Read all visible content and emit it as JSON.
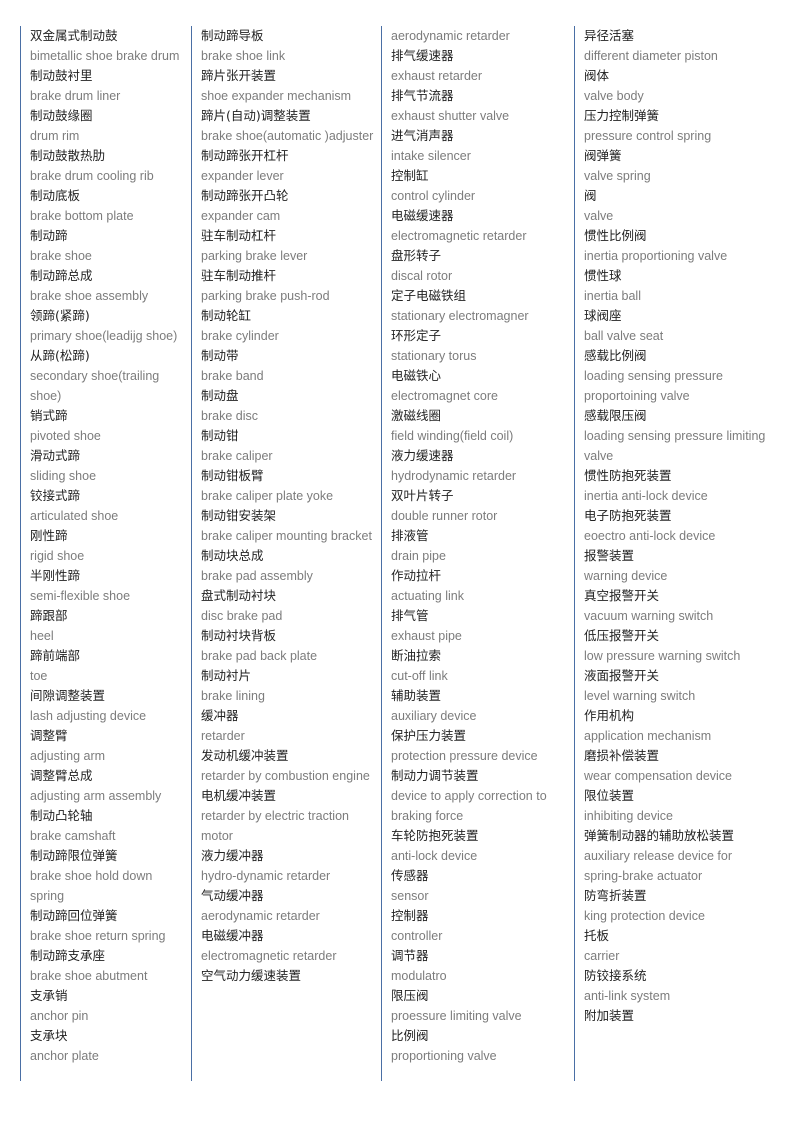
{
  "document": {
    "title": "Brake Component Chinese-English Glossary",
    "colors": {
      "column_rule": "#4a6fa5",
      "chinese_text": "#222222",
      "english_text": "#7c7c7c",
      "background": "#ffffff"
    }
  },
  "columns": [
    {
      "id": "column-1",
      "entries": [
        {
          "cn": "双金属式制动鼓",
          "en": "bimetallic shoe brake drum"
        },
        {
          "cn": "制动鼓衬里",
          "en": "brake drum liner"
        },
        {
          "cn": "制动鼓缘圈",
          "en": "drum rim"
        },
        {
          "cn": "制动鼓散热肋",
          "en": "brake drum cooling rib"
        },
        {
          "cn": "制动底板",
          "en": "brake bottom plate"
        },
        {
          "cn": "制动蹄",
          "en": "brake shoe"
        },
        {
          "cn": "制动蹄总成",
          "en": "brake shoe assembly"
        },
        {
          "cn": "领蹄(紧蹄)",
          "en": "primary shoe(leadijg shoe)"
        },
        {
          "cn": "从蹄(松蹄)",
          "en": "secondary shoe(trailing shoe)"
        },
        {
          "cn": "销式蹄",
          "en": "pivoted shoe"
        },
        {
          "cn": "滑动式蹄",
          "en": "sliding shoe"
        },
        {
          "cn": "铰接式蹄",
          "en": "articulated shoe"
        },
        {
          "cn": "刚性蹄",
          "en": "rigid shoe"
        },
        {
          "cn": "半刚性蹄",
          "en": "semi-flexible shoe"
        },
        {
          "cn": "蹄跟部",
          "en": "heel"
        },
        {
          "cn": "蹄前端部",
          "en": "toe"
        },
        {
          "cn": "间隙调整装置",
          "en": "lash adjusting device"
        },
        {
          "cn": "调整臂",
          "en": "adjusting arm"
        },
        {
          "cn": "调整臂总成",
          "en": "adjusting arm assembly"
        },
        {
          "cn": "制动凸轮轴",
          "en": "brake camshaft"
        },
        {
          "cn": "制动蹄限位弹簧",
          "en": "brake shoe hold down spring"
        },
        {
          "cn": "制动蹄回位弹簧",
          "en": "brake shoe return spring"
        },
        {
          "cn": "制动蹄支承座",
          "en": "brake shoe abutment"
        },
        {
          "cn": "支承销",
          "en": "anchor pin"
        },
        {
          "cn": "支承块",
          "en": "anchor plate"
        }
      ]
    },
    {
      "id": "column-2",
      "entries": [
        {
          "cn": "制动蹄导板",
          "en": "brake shoe link"
        },
        {
          "cn": "蹄片张开装置",
          "en": "shoe expander mechanism"
        },
        {
          "cn": "蹄片(自动)调整装置",
          "en": "brake shoe(automatic )adjuster"
        },
        {
          "cn": "制动蹄张开杠杆",
          "en": "expander lever"
        },
        {
          "cn": "制动蹄张开凸轮",
          "en": "expander cam"
        },
        {
          "cn": "驻车制动杠杆",
          "en": "parking brake lever"
        },
        {
          "cn": "驻车制动推杆",
          "en": "parking brake push-rod"
        },
        {
          "cn": "制动轮缸",
          "en": "brake cylinder"
        },
        {
          "cn": "制动带",
          "en": "brake band"
        },
        {
          "cn": "制动盘",
          "en": "brake disc"
        },
        {
          "cn": "制动钳",
          "en": "brake caliper"
        },
        {
          "cn": "制动钳板臂",
          "en": "brake caliper plate yoke"
        },
        {
          "cn": "制动钳安装架",
          "en": "brake caliper mounting bracket"
        },
        {
          "cn": "制动块总成",
          "en": "brake pad assembly"
        },
        {
          "cn": "盘式制动衬块",
          "en": "disc brake pad"
        },
        {
          "cn": "制动衬块背板",
          "en": "brake pad back plate"
        },
        {
          "cn": "制动衬片",
          "en": "brake lining"
        },
        {
          "cn": "缓冲器",
          "en": "retarder"
        },
        {
          "cn": "发动机缓冲装置",
          "en": "retarder by combustion engine"
        },
        {
          "cn": "电机缓冲装置",
          "en": "retarder by electric traction motor"
        },
        {
          "cn": "液力缓冲器",
          "en": "hydro-dynamic retarder"
        },
        {
          "cn": "气动缓冲器",
          "en": "aerodynamic retarder"
        },
        {
          "cn": "电磁缓冲器",
          "en": "electromagnetic retarder"
        },
        {
          "cn": "空气动力缓速装置",
          "en": ""
        }
      ]
    },
    {
      "id": "column-3",
      "entries": [
        {
          "cn": "",
          "en": "aerodynamic retarder"
        },
        {
          "cn": "排气缓速器",
          "en": "exhaust retarder"
        },
        {
          "cn": "排气节流器",
          "en": "exhaust shutter valve"
        },
        {
          "cn": "进气消声器",
          "en": "intake silencer"
        },
        {
          "cn": "控制缸",
          "en": "control cylinder"
        },
        {
          "cn": "电磁缓速器",
          "en": "electromagnetic retarder"
        },
        {
          "cn": "盘形转子",
          "en": "discal rotor"
        },
        {
          "cn": "定子电磁铁组",
          "en": "stationary electromagner"
        },
        {
          "cn": "环形定子",
          "en": "stationary torus"
        },
        {
          "cn": "电磁铁心",
          "en": "electromagnet core"
        },
        {
          "cn": "激磁线圈",
          "en": "field winding(field coil)"
        },
        {
          "cn": "液力缓速器",
          "en": "hydrodynamic retarder"
        },
        {
          "cn": "双叶片转子",
          "en": "double runner rotor"
        },
        {
          "cn": "排液管",
          "en": "drain pipe"
        },
        {
          "cn": "作动拉杆",
          "en": "actuating link"
        },
        {
          "cn": "排气管",
          "en": "exhaust pipe"
        },
        {
          "cn": "断油拉索",
          "en": "cut-off link"
        },
        {
          "cn": "辅助装置",
          "en": "auxiliary device"
        },
        {
          "cn": "保护压力装置",
          "en": "protection pressure device"
        },
        {
          "cn": "制动力调节装置",
          "en": "device to apply correction to braking force"
        },
        {
          "cn": "车轮防抱死装置",
          "en": "anti-lock device"
        },
        {
          "cn": "传感器",
          "en": "sensor"
        },
        {
          "cn": "控制器",
          "en": "controller"
        },
        {
          "cn": "调节器",
          "en": "modulatro"
        },
        {
          "cn": "限压阀",
          "en": "proessure limiting valve"
        },
        {
          "cn": "比例阀",
          "en": "proportioning valve"
        }
      ]
    },
    {
      "id": "column-4",
      "entries": [
        {
          "cn": "异径活塞",
          "en": "different diameter piston"
        },
        {
          "cn": "阀体",
          "en": "valve body"
        },
        {
          "cn": "压力控制弹簧",
          "en": "pressure control spring"
        },
        {
          "cn": "阀弹簧",
          "en": "valve spring"
        },
        {
          "cn": "阀",
          "en": "valve"
        },
        {
          "cn": "惯性比例阀",
          "en": "inertia proportioning valve"
        },
        {
          "cn": "惯性球",
          "en": "inertia ball"
        },
        {
          "cn": "球阀座",
          "en": "ball valve seat"
        },
        {
          "cn": "感载比例阀",
          "en": "loading sensing pressure proportoining valve"
        },
        {
          "cn": "感载限压阀",
          "en": "loading sensing pressure limiting valve"
        },
        {
          "cn": "惯性防抱死装置",
          "en": "inertia anti-lock device"
        },
        {
          "cn": "电子防抱死装置",
          "en": "eoectro anti-lock device"
        },
        {
          "cn": "报警装置",
          "en": "warning device"
        },
        {
          "cn": "真空报警开关",
          "en": "vacuum warning switch"
        },
        {
          "cn": "低压报警开关",
          "en": "low pressure warning switch"
        },
        {
          "cn": "液面报警开关",
          "en": "level warning switch"
        },
        {
          "cn": "作用机构",
          "en": "application mechanism"
        },
        {
          "cn": "磨损补偿装置",
          "en": "wear compensation device"
        },
        {
          "cn": "限位装置",
          "en": "inhibiting device"
        },
        {
          "cn": "弹簧制动器的辅助放松装置",
          "en": "auxiliary release device for spring-brake actuator"
        },
        {
          "cn": "防弯折装置",
          "en": "king protection device"
        },
        {
          "cn": "托板",
          "en": "carrier"
        },
        {
          "cn": "防铰接系统",
          "en": "anti-link system"
        },
        {
          "cn": "附加装置",
          "en": ""
        }
      ]
    }
  ]
}
